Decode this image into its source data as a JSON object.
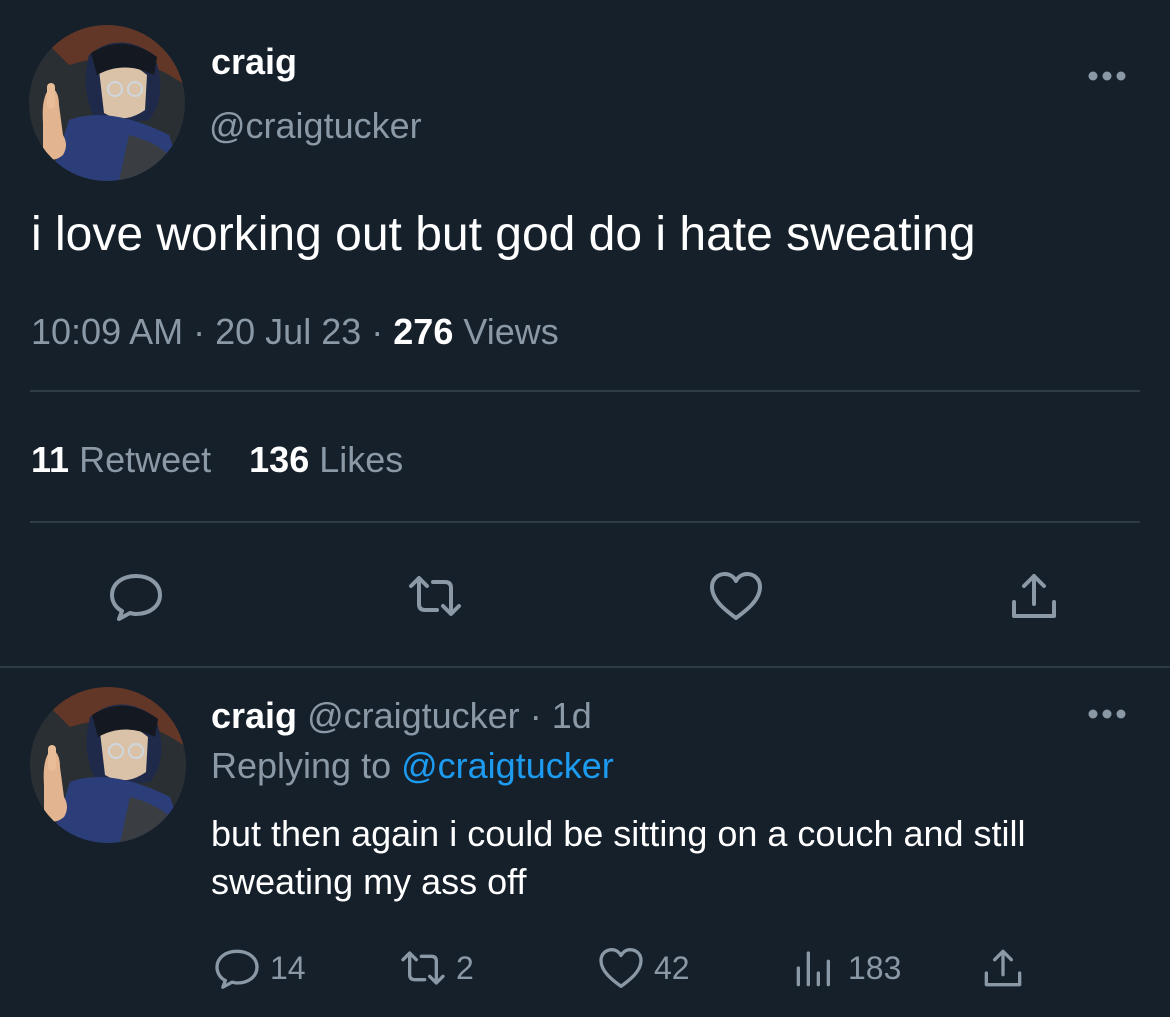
{
  "colors": {
    "background": "#15202b",
    "text_primary": "#ffffff",
    "text_secondary": "#8b98a5",
    "accent": "#1d9bf0",
    "divider": "#2f3b47"
  },
  "main_tweet": {
    "display_name": "craig",
    "handle": "@craigtucker",
    "text": "i love working out but god do i hate sweating",
    "time": "10:09 AM",
    "separator": "·",
    "date": "20 Jul 23",
    "views_count": "276",
    "views_label": "Views",
    "retweet_count": "11",
    "retweet_label": "Retweet",
    "likes_count": "136",
    "likes_label": "Likes",
    "icons": {
      "more": "more-dots-icon",
      "reply": "reply-bubble-icon",
      "retweet": "retweet-icon",
      "like": "heart-icon",
      "share": "share-icon"
    }
  },
  "reply_tweet": {
    "display_name": "craig",
    "handle": "@craigtucker",
    "separator": "·",
    "age": "1d",
    "replying_prefix": "Replying to",
    "replying_to": "@craigtucker",
    "text": "but then again i could be sitting on a couch and still sweating my ass off",
    "reply_count": "14",
    "retweet_count": "2",
    "like_count": "42",
    "view_count": "183",
    "icons": {
      "more": "more-dots-icon",
      "reply": "reply-bubble-icon",
      "retweet": "retweet-icon",
      "like": "heart-icon",
      "views": "views-bars-icon",
      "share": "share-icon"
    }
  }
}
